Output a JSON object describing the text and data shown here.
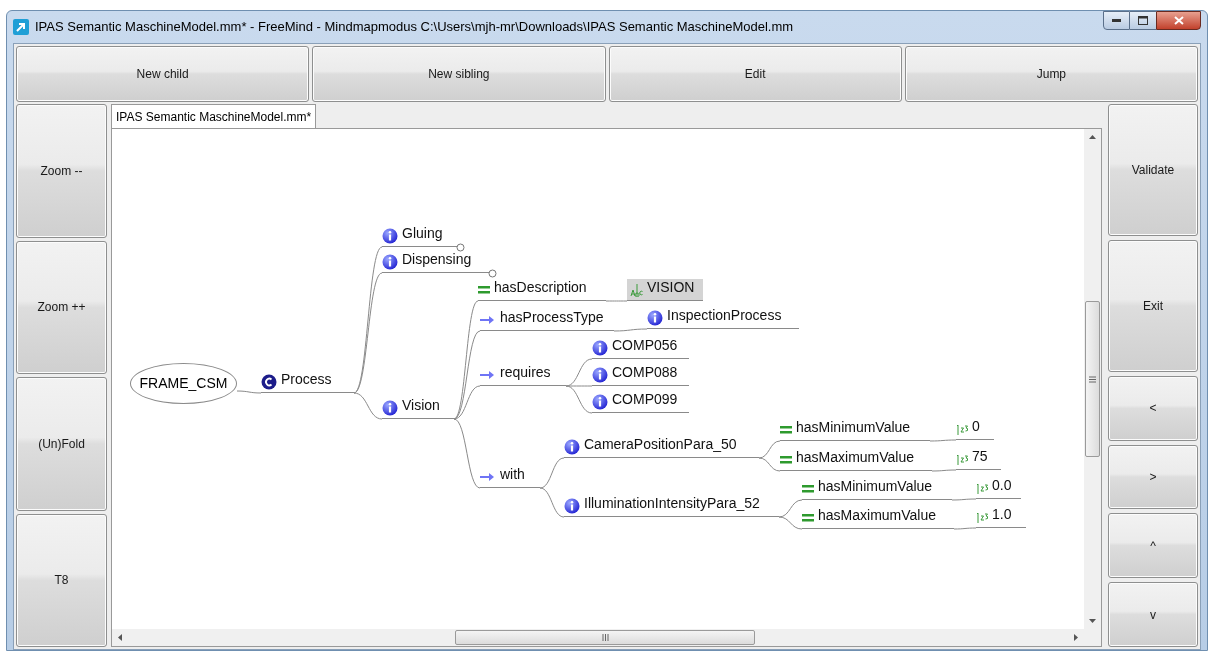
{
  "window": {
    "title": "IPAS Semantic MaschineModel.mm* - FreeMind - Mindmapmodus C:\\Users\\mjh-mr\\Downloads\\IPAS Semantic MaschineModel.mm"
  },
  "toolbar": [
    "New child",
    "New sibling",
    "Edit",
    "Jump"
  ],
  "left_buttons": [
    "Zoom --",
    "Zoom ++",
    "(Un)Fold",
    "T8"
  ],
  "right_buttons": [
    "Validate",
    "Exit",
    "<",
    ">",
    "^",
    "v"
  ],
  "tabs": [
    {
      "label": "IPAS Semantic MaschineModel.mm*",
      "selected": true
    }
  ],
  "map": {
    "root": {
      "label": "FRAME_CSM",
      "children": [
        {
          "kind": "class",
          "label": "Process",
          "folded": false,
          "children": [
            {
              "kind": "individual",
              "label": "Gluing",
              "folded": true
            },
            {
              "kind": "individual",
              "label": "Dispensing",
              "folded": true
            },
            {
              "kind": "individual",
              "label": "Vision",
              "folded": false,
              "children": [
                {
                  "kind": "data-property",
                  "label": "hasDescription",
                  "folded": false,
                  "children": [
                    {
                      "kind": "literal",
                      "label": "VISION",
                      "folded": false
                    }
                  ]
                },
                {
                  "kind": "object-property",
                  "label": "hasProcessType",
                  "folded": false,
                  "children": [
                    {
                      "kind": "individual",
                      "label": "InspectionProcess",
                      "folded": false
                    }
                  ]
                },
                {
                  "kind": "object-property",
                  "label": "requires",
                  "folded": false,
                  "children": [
                    {
                      "kind": "individual",
                      "label": "COMP056",
                      "folded": false
                    },
                    {
                      "kind": "individual",
                      "label": "COMP088",
                      "folded": false
                    },
                    {
                      "kind": "individual",
                      "label": "COMP099",
                      "folded": false
                    }
                  ]
                },
                {
                  "kind": "object-property",
                  "label": "with",
                  "folded": false,
                  "children": [
                    {
                      "kind": "individual",
                      "label": "CameraPositionPara_50",
                      "folded": false,
                      "children": [
                        {
                          "kind": "data-property",
                          "label": "hasMinimumValue",
                          "folded": false,
                          "children": [
                            {
                              "kind": "number",
                              "label": "0",
                              "folded": false
                            }
                          ]
                        },
                        {
                          "kind": "data-property",
                          "label": "hasMaximumValue",
                          "folded": false,
                          "children": [
                            {
                              "kind": "number",
                              "label": "75",
                              "folded": false
                            }
                          ]
                        }
                      ]
                    },
                    {
                      "kind": "individual",
                      "label": "IlluminationIntensityPara_52",
                      "folded": false,
                      "children": [
                        {
                          "kind": "data-property",
                          "label": "hasMinimumValue",
                          "folded": false,
                          "children": [
                            {
                              "kind": "number",
                              "label": "0.0",
                              "folded": false
                            }
                          ]
                        },
                        {
                          "kind": "data-property",
                          "label": "hasMaximumValue",
                          "folded": false,
                          "children": [
                            {
                              "kind": "number",
                              "label": "1.0",
                              "folded": false
                            }
                          ]
                        }
                      ]
                    }
                  ]
                }
              ]
            }
          ]
        }
      ]
    }
  }
}
